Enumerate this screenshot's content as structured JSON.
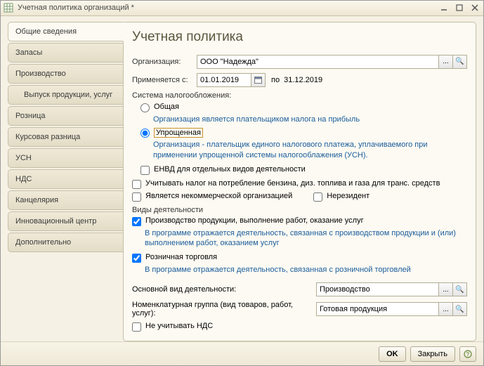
{
  "window": {
    "title": "Учетная политика организаций *"
  },
  "tabs": [
    "Общие сведения",
    "Запасы",
    "Производство",
    "Выпуск продукции, услуг",
    "Розница",
    "Курсовая разница",
    "УСН",
    "НДС",
    "Канцелярия",
    "Инновационный центр",
    "Дополнительно"
  ],
  "heading": "Учетная политика",
  "labels": {
    "org": "Организация:",
    "applies_from": "Применяется с:",
    "to": "по",
    "tax_system": "Система налогообложения:",
    "activity_types": "Виды деятельности",
    "main_activity": "Основной вид деятельности:",
    "nom_group": "Номенклатурная группа (вид товаров, работ, услуг):"
  },
  "values": {
    "org": "ООО \"Надежда\"",
    "date_from": "01.01.2019",
    "date_to": "31.12.2019",
    "main_activity": "Производство",
    "nom_group": "Готовая продукция"
  },
  "radios": {
    "general": "Общая",
    "general_hint": "Организация является плательщиком налога на прибыль",
    "simplified": "Упрощенная",
    "simplified_hint": "Организация - плательщик единого налогового платежа, уплачиваемого при применении упрощенной системы налогооблажения (УСН)."
  },
  "checks": {
    "envd": "ЕНВД для отдельных видов деятельности",
    "fuel_tax": "Учитывать налог на потребление бензина, диз. топлива и газа для транс. средств",
    "noncommercial": "Является некоммерческой организацией",
    "nonresident": "Нерезидент",
    "prod_activity": "Производство  продукции, выполнение работ, оказание услуг",
    "prod_hint": "В программе отражается деятельность, связанная с производством продукции и (или) выполнением работ, оказанием услуг",
    "retail_activity": "Розничная торговля",
    "retail_hint": "В программе отражается деятельность, связанная с розничной торговлей",
    "no_vat": "Не учитывать НДС"
  },
  "buttons": {
    "ok": "OK",
    "close": "Закрыть",
    "ellipsis": "...",
    "search": "🔍"
  }
}
